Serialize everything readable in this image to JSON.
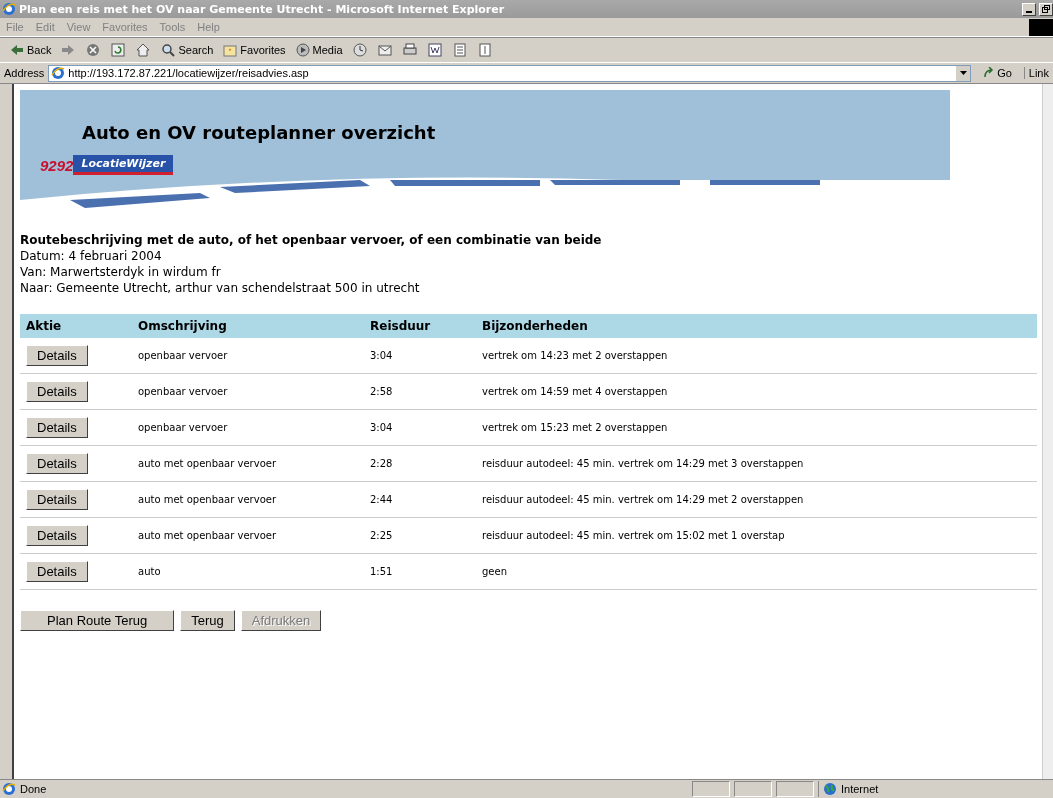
{
  "window": {
    "title": "Plan een reis met het OV naar Gemeente Utrecht - Microsoft Internet Explorer"
  },
  "menu": [
    "File",
    "Edit",
    "View",
    "Favorites",
    "Tools",
    "Help"
  ],
  "toolbar": [
    {
      "kind": "back",
      "label": "Back"
    },
    {
      "kind": "forward"
    },
    {
      "kind": "stop"
    },
    {
      "kind": "refresh"
    },
    {
      "kind": "home"
    },
    {
      "kind": "search",
      "label": "Search"
    },
    {
      "kind": "favorites",
      "label": "Favorites"
    },
    {
      "kind": "media",
      "label": "Media"
    },
    {
      "kind": "history"
    },
    {
      "kind": "mail"
    },
    {
      "kind": "print"
    },
    {
      "kind": "edit"
    },
    {
      "kind": "discuss"
    },
    {
      "kind": "messenger"
    }
  ],
  "address": {
    "label": "Address",
    "value": "http://193.172.87.221/locatiewijzer/reisadvies.asp",
    "go": "Go",
    "links": "Link"
  },
  "banner": {
    "heading": "Auto en OV routeplanner overzicht",
    "logo_number": "9292",
    "logo_name": "LocatieWijzer"
  },
  "summary": {
    "title": "Routebeschrijving met de auto, of het openbaar vervoer, of een combinatie van beide",
    "lines": [
      "Datum: 4 februari 2004",
      "Van: Marwertsterdyk in wirdum fr",
      "Naar: Gemeente Utrecht, arthur van schendelstraat 500 in utrecht"
    ]
  },
  "table": {
    "columns": [
      "Aktie",
      "Omschrijving",
      "Reisduur",
      "Bijzonderheden"
    ],
    "rows": [
      {
        "action": "Details",
        "description": "openbaar vervoer",
        "duration": "3:04",
        "details": "vertrek om 14:23 met 2 overstappen"
      },
      {
        "action": "Details",
        "description": "openbaar vervoer",
        "duration": "2:58",
        "details": "vertrek om 14:59 met 4 overstappen"
      },
      {
        "action": "Details",
        "description": "openbaar vervoer",
        "duration": "3:04",
        "details": "vertrek om 15:23 met 2 overstappen"
      },
      {
        "action": "Details",
        "description": "auto met openbaar vervoer",
        "duration": "2:28",
        "details": "reisduur autodeel: 45 min. vertrek om 14:29 met 3 overstappen"
      },
      {
        "action": "Details",
        "description": "auto met openbaar vervoer",
        "duration": "2:44",
        "details": "reisduur autodeel: 45 min. vertrek om 14:29 met 2 overstappen"
      },
      {
        "action": "Details",
        "description": "auto met openbaar vervoer",
        "duration": "2:25",
        "details": "reisduur autodeel: 45 min. vertrek om 15:02 met 1 overstap"
      },
      {
        "action": "Details",
        "description": "auto",
        "duration": "1:51",
        "details": "geen"
      }
    ]
  },
  "buttons": [
    {
      "label": "Plan Route Terug",
      "disabled": false
    },
    {
      "label": "Terug",
      "disabled": false
    },
    {
      "label": "Afdrukken",
      "disabled": true
    }
  ],
  "status_bar": {
    "text": "Done",
    "zone": "Internet"
  }
}
